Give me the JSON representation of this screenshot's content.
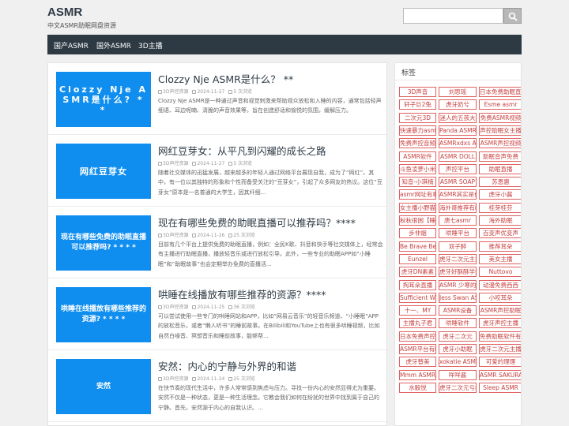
{
  "site": {
    "title": "ASMR",
    "tagline": "中文ASMR助眠网盘资源"
  },
  "search": {
    "placeholder": "",
    "icon": "search-icon"
  },
  "nav": {
    "items": [
      "国产ASMR",
      "国外ASMR",
      "3D主播"
    ]
  },
  "posts": [
    {
      "thumb_text": "Clozzy Nje ASMR是什么? * *",
      "title": "Clozzy Nje ASMR是什么？ **",
      "category": "3D声控资源",
      "date": "2024-11-27",
      "views": "5 次浏览",
      "excerpt": "Clozzy Nje ASMR是一种通过声音和视觉刺激来帮助观众放松和入睡的内容，通常包括轻声细语、耳边呢喃、清脆的声音效果等，旨在创造舒适和愉悦的氛围，缓解压力。"
    },
    {
      "thumb_text": "网红豆芽女",
      "title": "网红豆芽女：从平凡到闪耀的成长之路",
      "category": "3D声控资源",
      "date": "2024-11-27",
      "views": "5 次浏览",
      "excerpt": "随着社交媒体的迅猛发展，越来越多的年轻人通过网络平台展现自我，成为了“网红”。其中，有一位以其独特的形象和个性而备受关注的“豆芽女”，引起了众多网友的热议。这位“豆芽女”原本是一名普通的大学生，因其纤细..."
    },
    {
      "thumb_text": "现在有哪些免费的助眠直播可以推荐吗? * * * *",
      "title": "现在有哪些免费的助眠直播可以推荐吗？****",
      "category": "3D声控资源",
      "date": "2024-11-26",
      "views": "25 次浏览",
      "excerpt": "目前有几个平台上提供免费的助眠直播，例如：全民K歌、抖音和快手等社交媒体上，经常会有主播进行助眠直播，播放轻音乐或进行放松引导。此外，一些专业的助眠APP如“小睡眠”和“助眠故事”也会定期举办免费的直播活..."
    },
    {
      "thumb_text": "哄睡在线播放有哪些推荐的资源? * * * *",
      "title": "哄睡在线播放有哪些推荐的资源？****",
      "category": "3D声控资源",
      "date": "2024-11-25",
      "views": "36 次浏览",
      "excerpt": "可以尝试使用一些专门的哄睡网站和APP，比如“网易云音乐”的轻音乐频道、“小睡眠”APP的放松音乐，或者“懒人听书”的睡前故事。在Bilibili和YouTube上也有很多哄睡视频，比如自然白噪音、冥想音乐和睡前故事，能够帮..."
    },
    {
      "thumb_text": "安然",
      "title": "安然：内心的宁静与外界的和谐",
      "category": "3D声控资源",
      "date": "2024-11-24",
      "views": "25 次浏览",
      "excerpt": "在快节奏的现代生活中，许多人常常感到焦虑与压力。寻找一份内心的安然显得尤为重要。安然不仅是一种状态，更是一种生活理念。它教会我们如何在纷扰的世界中找到属于自己的宁静。首先，安然源于内心的自我认识。..."
    }
  ],
  "sidebar": {
    "title": "标签",
    "tags": [
      "3D声音",
      "刘思瑶",
      "日本免费助眠直播",
      "轩子巨2兔",
      "虎牙奶兮",
      "Esme asmr",
      "二次元3D",
      "迷人的五孩大",
      "免费ASMR视频",
      "快速暴力asmr助眠",
      "Panda ASMR",
      "声控助眠女主播",
      "免费声控音频视频",
      "ASMRxdxs ASMR",
      "ASMR声控视频",
      "ASMR软件",
      "ASMR DOLL",
      "助眠音声免费",
      "斗鱼凌萝小米",
      "声控平台",
      "助眠直播",
      "知音-小琪楠",
      "ASMR SOAP",
      "苏恩惠",
      "asmr网址有哪些",
      "ASMR其实是什么",
      "虎牙小酱",
      "女主播小野猫",
      "海外哥推荐有哪些",
      "桂芽桂芬",
      "秋秋很困【睡播王】",
      "唐七asmr",
      "海外助眠",
      "步非烟",
      "哄睡平台",
      "百变声优变声",
      "Be Brave Be Bold Be Kind",
      "双子醉",
      "推荐耳朵",
      "Eunzel",
      "虎牙二次元主播推荐",
      "美女主播",
      "虎牙DN素素",
      "虎牙好酥酥学姐",
      "Nuttovo",
      "掏耳朵直播",
      "ASMR 少寒的心",
      "动漫免费西西",
      "Sufficient Whispers",
      "Jess Swan ASMR",
      "小咬耳朵",
      "十一、MY",
      "ASMR设备",
      "ASMR声控助眠",
      "主播丸子君",
      "哄睡软件",
      "虎牙声控主播",
      "日本免费声控助眠视频",
      "虎牙二次元",
      "免费助眠软件有哪些",
      "ASMR平台有哪些",
      "虎牙小助眠",
      "虎牙二次元主播",
      "虎牙替美",
      "xokatie ASMR",
      "可爱的理理",
      "Mmm ASMR",
      "咩咩酱",
      "ASMR SAKURA",
      "水骰悦",
      "虎牙二次元亏损",
      "Sleep ASMR"
    ]
  },
  "colors": {
    "nav_bg": "#2d3a44",
    "thumb_bg": "#108ef0",
    "tag_border": "#e06060",
    "tag_text": "#c84040"
  }
}
